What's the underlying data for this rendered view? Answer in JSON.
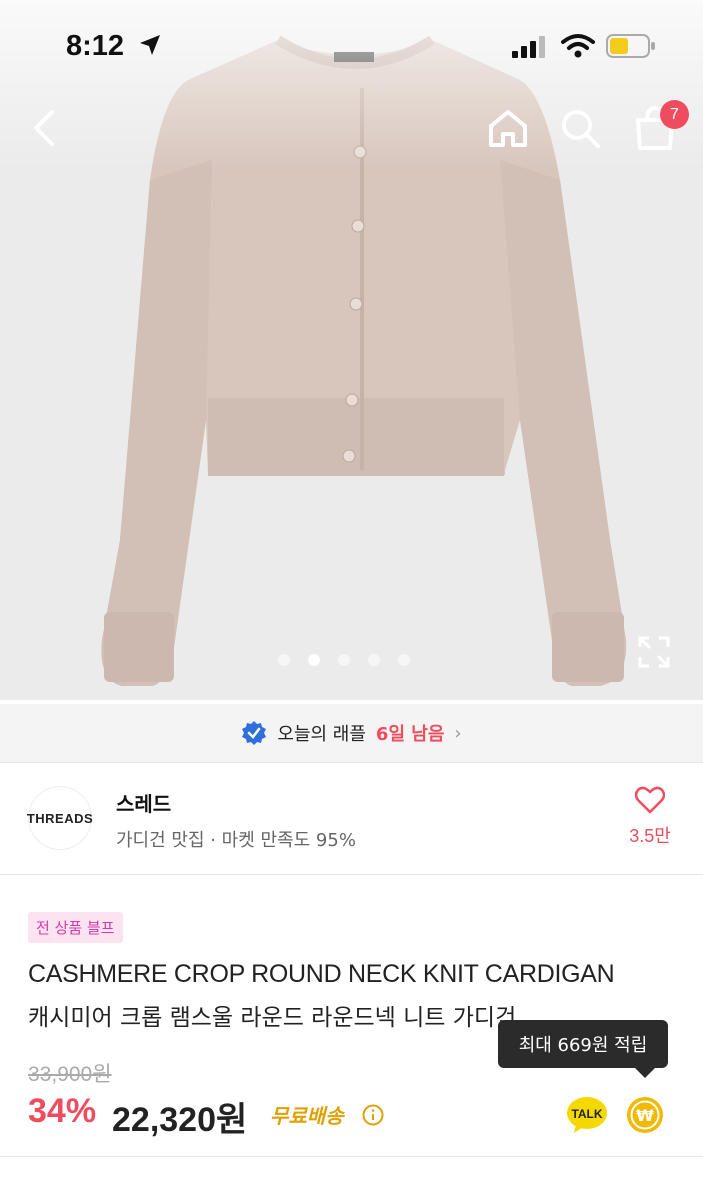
{
  "status_bar": {
    "time": "8:12"
  },
  "nav": {
    "cart_count": "7"
  },
  "gallery": {
    "dot_count": 5,
    "active_index": 1
  },
  "raffle": {
    "label": "오늘의 래플",
    "highlight": "6일 남음"
  },
  "store": {
    "logo_text": "THREADS",
    "name": "스레드",
    "description": "가디건 맛집 · 마켓 만족도 95%",
    "like_count": "3.5만"
  },
  "product": {
    "promo_badge": "전 상품 블프",
    "title_en": "CASHMERE CROP ROUND NECK KNIT CARDIGAN",
    "title_kr": "캐시미어 크롭 램스울 라운드 라운드넥 니트 가디건",
    "tooltip": "최대 669원 적립",
    "original_price": "33,900원",
    "discount": "34%",
    "price": "22,320원",
    "shipping": "무료배송",
    "talk_label": "TALK",
    "coin_label": "₩"
  },
  "colors": {
    "accent": "#ef4d5f",
    "promo_bg": "#fbe3f2",
    "promo_text": "#d63aa6",
    "shipping": "#e0a000",
    "verified": "#2f6fdc",
    "talk": "#f5d800",
    "coin": "#f3b900"
  }
}
